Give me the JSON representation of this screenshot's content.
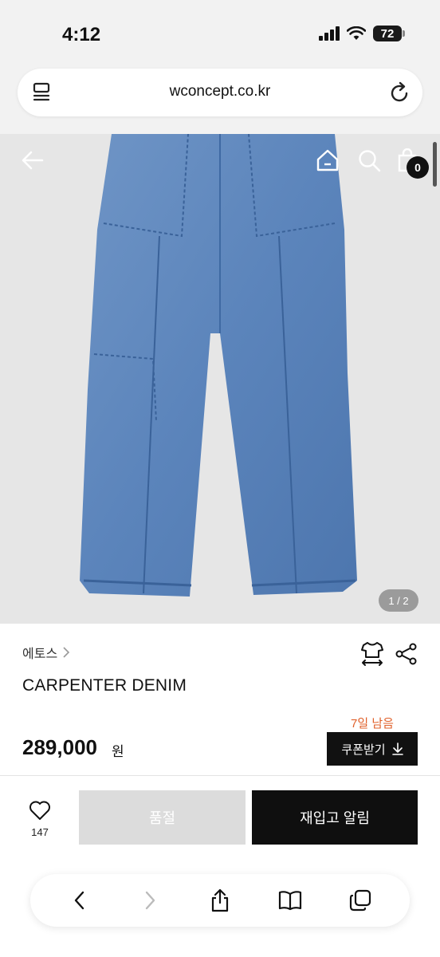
{
  "status_bar": {
    "time": "4:12",
    "battery": "72"
  },
  "browser": {
    "url": "wconcept.co.kr"
  },
  "product_header": {
    "cart_count": "0"
  },
  "gallery": {
    "pager": "1 / 2"
  },
  "product": {
    "brand": "에토스",
    "name": "CARPENTER DENIM",
    "price": "289,000",
    "price_unit": "원",
    "coupon_deadline": "7일 남음",
    "coupon_label": "쿠폰받기"
  },
  "actions": {
    "like_count": "147",
    "soldout_label": "품절",
    "restock_label": "재입고 알림"
  },
  "colors": {
    "accent_orange": "#e0602a",
    "denim": "#5b84bb",
    "dark_button": "#0f0f0f"
  }
}
